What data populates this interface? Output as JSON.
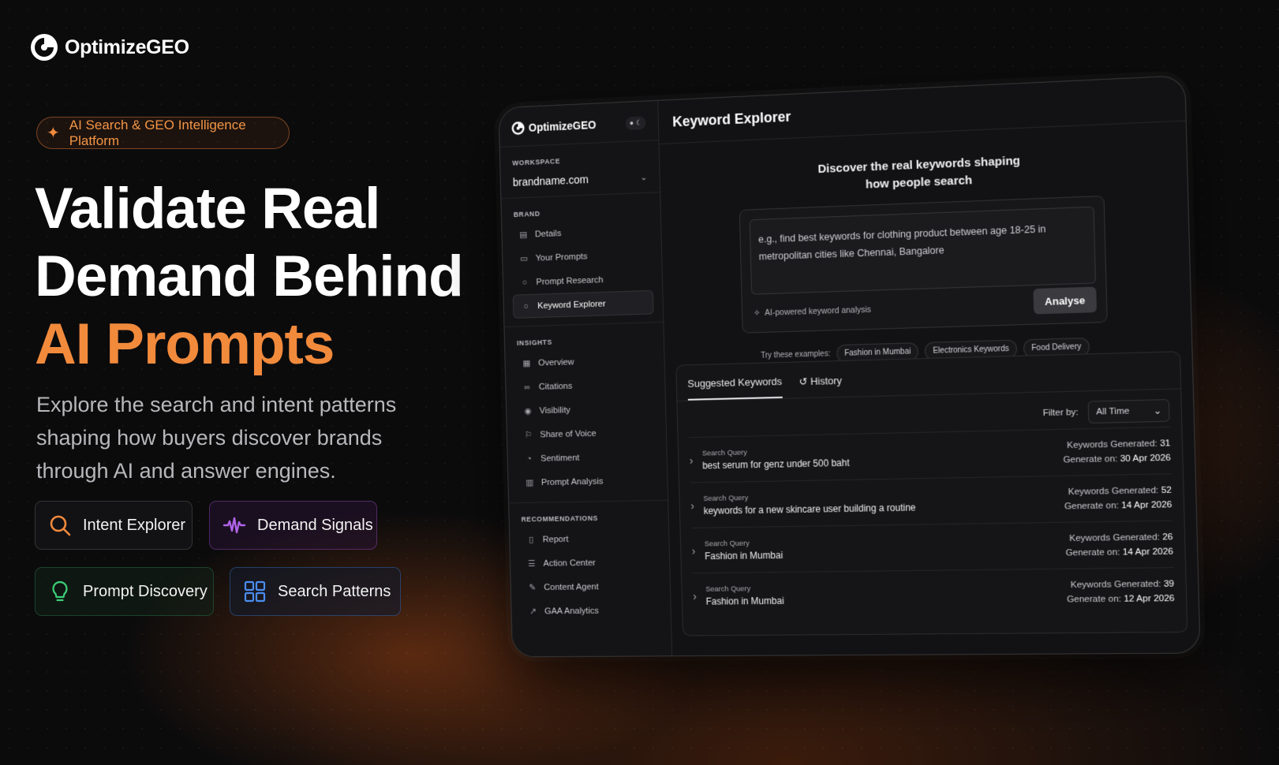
{
  "brand": {
    "name": "OptimizeGEO"
  },
  "hero": {
    "pill": "AI Search & GEO Intelligence Platform",
    "headline_line1": "Validate Real",
    "headline_line2": "Demand Behind",
    "headline_accent": "AI Prompts",
    "subhead": "Explore the search and intent patterns shaping how buyers discover brands through AI and answer engines.",
    "features": [
      {
        "label": "Intent Explorer",
        "icon": "search-icon"
      },
      {
        "label": "Demand Signals",
        "icon": "waveform-icon"
      },
      {
        "label": "Prompt Discovery",
        "icon": "lightbulb-icon"
      },
      {
        "label": "Search Patterns",
        "icon": "grid-icon"
      }
    ]
  },
  "app": {
    "sidebar": {
      "brand": "OptimizeGEO",
      "workspace_label": "WORKSPACE",
      "workspace_value": "brandname.com",
      "brand_label": "BRAND",
      "brand_items": [
        "Details",
        "Your Prompts",
        "Prompt Research",
        "Keyword Explorer"
      ],
      "insights_label": "INSIGHTS",
      "insights_items": [
        "Overview",
        "Citations",
        "Visibility",
        "Share of Voice",
        "Sentiment",
        "Prompt Analysis"
      ],
      "recommendations_label": "RECOMMENDATIONS",
      "recommendations_items": [
        "Report",
        "Action Center",
        "Content Agent",
        "GAA Analytics"
      ]
    },
    "main": {
      "title": "Keyword Explorer",
      "discover_line1": "Discover the real keywords shaping",
      "discover_line2": "how people search",
      "query_line1": "e.g., find best keywords for clothing product between age 18-25 in",
      "query_line2": "metropolitan cities like Chennai, Bangalore",
      "ai_note": "AI-powered keyword analysis",
      "analyse_label": "Analyse",
      "examples_label": "Try these examples:",
      "examples": [
        "Fashion in Mumbai",
        "Electronics Keywords",
        "Food Delivery"
      ],
      "tabs": [
        "Suggested Keywords",
        "History"
      ],
      "filter_label": "Filter by:",
      "filter_value": "All Time",
      "query_label": "Search Query",
      "generated_label": "Keywords Generated:",
      "generate_on_label": "Generate on:",
      "rows": [
        {
          "query": "best serum for genz under 500 baht",
          "count": "31",
          "date": "30 Apr 2026"
        },
        {
          "query": "keywords for a new skincare user building a routine",
          "count": "52",
          "date": "14 Apr 2026"
        },
        {
          "query": "Fashion in Mumbai",
          "count": "26",
          "date": "14 Apr 2026"
        },
        {
          "query": "Fashion in Mumbai",
          "count": "39",
          "date": "12 Apr 2026"
        }
      ]
    }
  },
  "colors": {
    "accent": "#f28a3c",
    "background": "#0b0b0c"
  }
}
